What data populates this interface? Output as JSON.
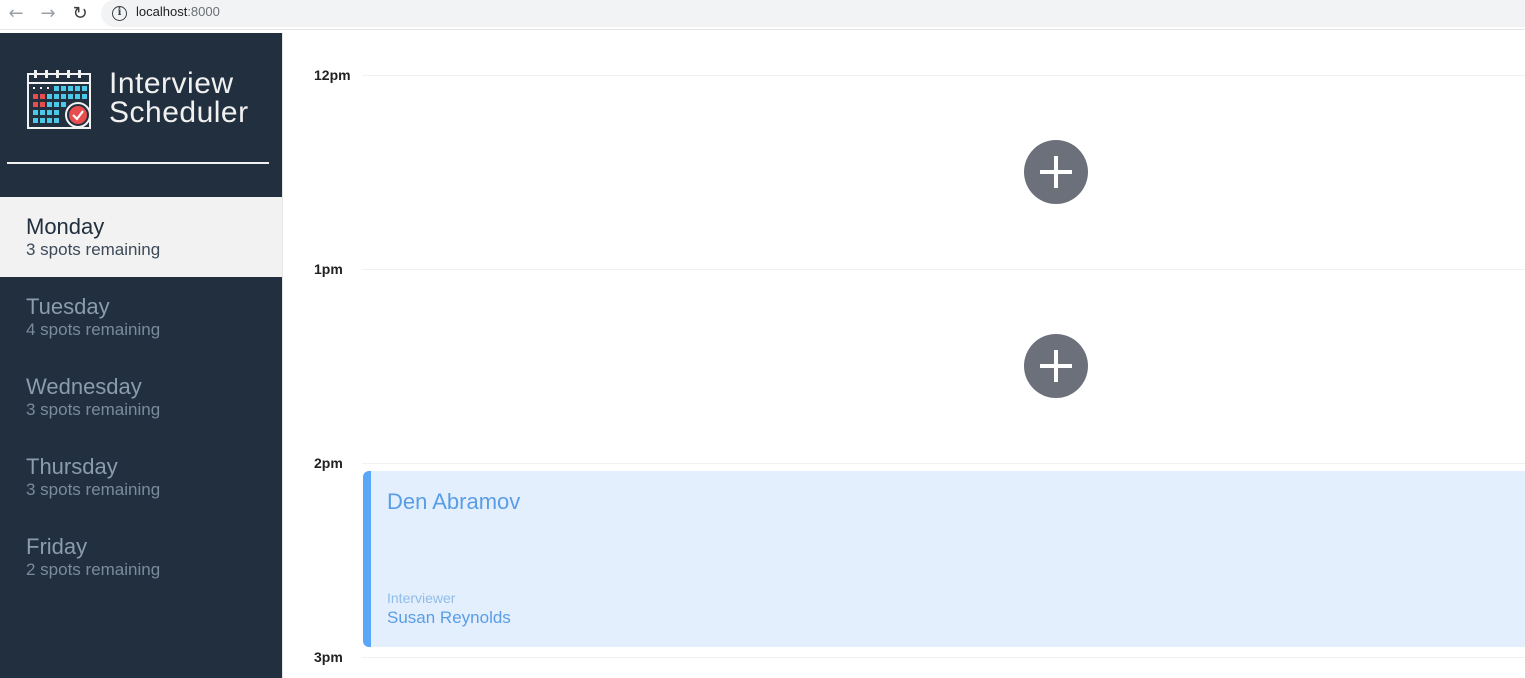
{
  "browser": {
    "url_host": "localhost",
    "url_port": ":8000"
  },
  "sidebar": {
    "brand_line1": "Interview",
    "brand_line2": "Scheduler",
    "days": [
      {
        "name": "Monday",
        "spots": "3 spots remaining",
        "selected": true
      },
      {
        "name": "Tuesday",
        "spots": "4 spots remaining",
        "selected": false
      },
      {
        "name": "Wednesday",
        "spots": "3 spots remaining",
        "selected": false
      },
      {
        "name": "Thursday",
        "spots": "3 spots remaining",
        "selected": false
      },
      {
        "name": "Friday",
        "spots": "2 spots remaining",
        "selected": false
      }
    ]
  },
  "schedule": {
    "slots": [
      {
        "time": "12pm"
      },
      {
        "time": "1pm"
      },
      {
        "time": "2pm"
      },
      {
        "time": "3pm"
      }
    ],
    "appointment": {
      "student": "Den Abramov",
      "interviewer_label": "Interviewer",
      "interviewer": "Susan Reynolds"
    }
  },
  "colors": {
    "sidebar_bg": "#222f3e",
    "appointment_bg": "#e3effd",
    "appointment_accent": "#5aa6f8",
    "add_button": "#6b707a"
  },
  "icons": {
    "back": "arrow-left-icon",
    "forward": "arrow-right-icon",
    "reload": "reload-icon",
    "info": "info-icon",
    "logo": "calendar-check-icon",
    "add": "plus-icon"
  }
}
